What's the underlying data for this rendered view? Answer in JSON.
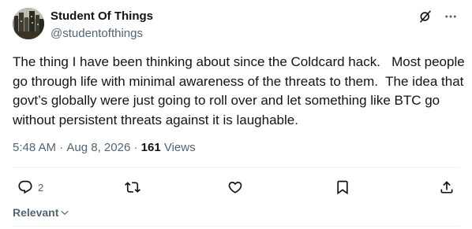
{
  "author": {
    "display_name": "Student Of Things",
    "handle": "@studentofthings",
    "avatar_icon": "profile-photo"
  },
  "top_actions": [
    {
      "icon": "grok-icon"
    },
    {
      "icon": "more-icon"
    }
  ],
  "post": {
    "text": "The thing I have been thinking about since the Coldcard hack.   Most people go through life with minimal awareness of the threats to them.  The idea that govt’s globally were just going to roll over and let something like BTC go without persistent threats against it is laughable."
  },
  "meta": {
    "time": "5:48 AM",
    "separator": " · ",
    "date": "Aug 8, 2026",
    "views_count": "161",
    "views_label": " Views"
  },
  "actions": {
    "reply_count": "2",
    "repost_count": "",
    "like_count": "",
    "bookmark_count": ""
  },
  "sort": {
    "label": "Relevant"
  },
  "colors": {
    "text": "#0f1419",
    "secondary": "#536471",
    "divider": "#eff3f4"
  }
}
